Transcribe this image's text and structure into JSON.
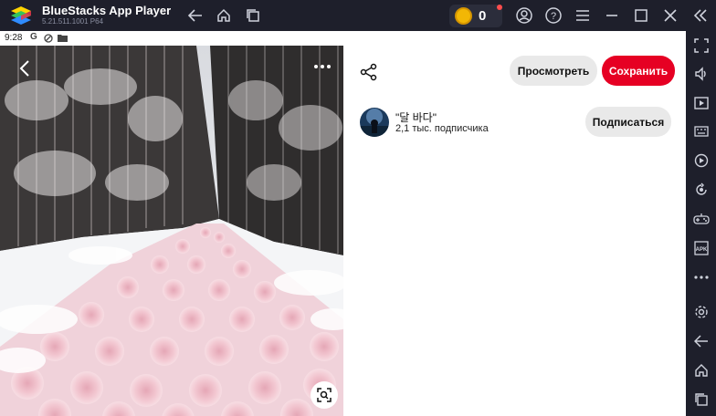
{
  "window": {
    "app_name": "BlueStacks App Player",
    "app_version": "5.21.511.1001 P64",
    "coins": "0",
    "titlebar_icons": [
      "back-icon",
      "home-icon",
      "multitask-icon",
      "account-icon",
      "help-icon",
      "menu-icon",
      "minimize-icon",
      "maximize-icon",
      "close-icon",
      "collapse-sidebar-icon"
    ]
  },
  "statusbar": {
    "time": "9:28"
  },
  "pin": {
    "view_label": "Просмотреть",
    "save_label": "Сохранить",
    "author": {
      "name": "\"달 바다\"",
      "subscribers": "2,1 тыс. подписчика",
      "subscribe_label": "Подписаться"
    }
  },
  "colors": {
    "save_button": "#e60023",
    "secondary_button": "#e9e9e9",
    "chrome": "#1e1f2b"
  },
  "sidebar": {
    "icons": [
      "fullscreen-icon",
      "volume-icon",
      "screen-record-icon",
      "keyboard-icon",
      "macro-icon",
      "rotate-icon",
      "gamepad-icon",
      "apk-icon",
      "more-icon",
      "settings-icon",
      "back-icon",
      "home-icon",
      "recents-icon"
    ]
  }
}
